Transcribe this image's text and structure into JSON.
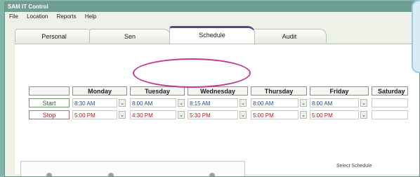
{
  "window": {
    "title": "SAM IT Control"
  },
  "menu": [
    "File",
    "Location",
    "Reports",
    "Help"
  ],
  "tabs": [
    {
      "label": "Personal",
      "active": false
    },
    {
      "label": "Sen",
      "active": false
    },
    {
      "label": "Schedule",
      "active": true
    },
    {
      "label": "Audit",
      "active": false
    }
  ],
  "schedule": {
    "days": [
      "Monday",
      "Tuesday",
      "Wednesday",
      "Thursday",
      "Friday",
      "Saturday"
    ],
    "start_label": "Start",
    "stop_label": "Stop",
    "start_times": [
      "8:30 AM",
      "8:00 AM",
      "8:15 AM",
      "8:00 AM",
      "8:00 AM"
    ],
    "stop_times": [
      "5:00 PM",
      "4:30 PM",
      "5:30 PM",
      "5:00 PM",
      "5:00 PM"
    ],
    "dropdown_glyph": "⌄"
  },
  "bottom": {
    "select_schedule_label": "Select Schedule"
  },
  "colors": {
    "start": "#1e4f8a",
    "stop": "#b01b1b",
    "highlight": "#c2398f",
    "active_tab": "#4a4d8a"
  }
}
